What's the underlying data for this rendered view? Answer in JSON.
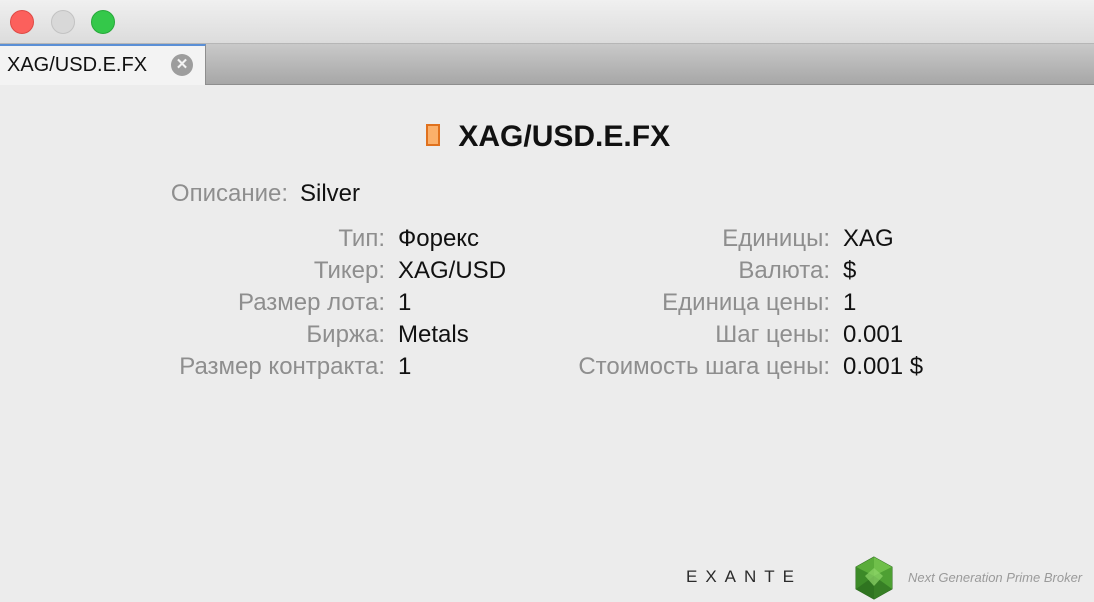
{
  "tab": {
    "label": "XAG/USD.E.FX"
  },
  "header": {
    "title": "XAG/USD.E.FX"
  },
  "description": {
    "label": "Описание:",
    "value": "Silver"
  },
  "left_fields": [
    {
      "label": "Тип:",
      "value": "Форекс"
    },
    {
      "label": "Тикер:",
      "value": "XAG/USD"
    },
    {
      "label": "Размер лота:",
      "value": "1"
    },
    {
      "label": "Биржа:",
      "value": "Metals"
    },
    {
      "label": "Размер контракта:",
      "value": "1"
    }
  ],
  "right_fields": [
    {
      "label": "Единицы:",
      "value": "XAG"
    },
    {
      "label": "Валюта:",
      "value": "$"
    },
    {
      "label": "Единица цены:",
      "value": "1"
    },
    {
      "label": "Шаг цены:",
      "value": "0.001"
    },
    {
      "label": "Стоимость шага цены:",
      "value": "0.001 $"
    }
  ],
  "footer": {
    "brand": "EXANTE",
    "tagline": "Next Generation Prime Broker"
  },
  "colors": {
    "instrument_icon": "#fbb06a",
    "label_gray": "#8e8e8e",
    "logo_green": "#4a9a32"
  }
}
